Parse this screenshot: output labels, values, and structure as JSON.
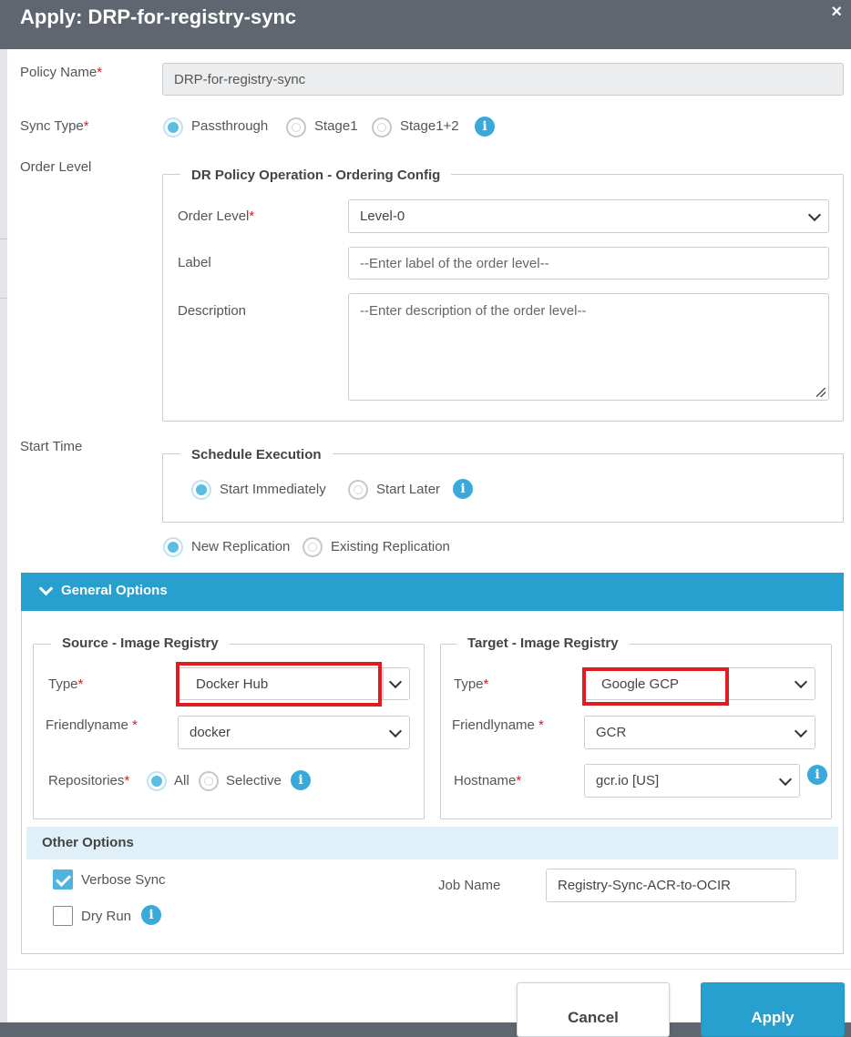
{
  "dialog": {
    "title": "Apply: DRP-for-registry-sync",
    "close_icon": "×"
  },
  "policy_name": {
    "label": "Policy Name",
    "value": "DRP-for-registry-sync"
  },
  "sync_type": {
    "label": "Sync Type",
    "options": [
      "Passthrough",
      "Stage1",
      "Stage1+2"
    ],
    "selected": "Passthrough"
  },
  "order_level": {
    "label": "Order Level",
    "legend": "DR Policy Operation - Ordering Config",
    "level_label": "Order Level",
    "level_value": "Level-0",
    "label_label": "Label",
    "label_placeholder": "--Enter label of the order level--",
    "description_label": "Description",
    "description_placeholder": "--Enter description of the order level--"
  },
  "start_time": {
    "label": "Start Time",
    "legend": "Schedule Execution",
    "options": [
      "Start Immediately",
      "Start Later"
    ],
    "selected": "Start Immediately"
  },
  "replication": {
    "options": [
      "New Replication",
      "Existing Replication"
    ],
    "selected": "New Replication"
  },
  "general_options": {
    "title": "General Options",
    "source": {
      "legend": "Source - Image Registry",
      "type_label": "Type",
      "type_value": "Docker Hub",
      "friendlyname_label": "Friendlyname",
      "friendlyname_value": "docker",
      "repositories_label": "Repositories",
      "repo_options": [
        "All",
        "Selective"
      ],
      "repo_selected": "All"
    },
    "target": {
      "legend": "Target - Image Registry",
      "type_label": "Type",
      "type_value": "Google GCP",
      "friendlyname_label": "Friendlyname",
      "friendlyname_value": "GCR",
      "hostname_label": "Hostname",
      "hostname_value": "gcr.io [US]"
    }
  },
  "other_options": {
    "title": "Other Options",
    "verbose_sync": {
      "label": "Verbose Sync",
      "checked": true
    },
    "dry_run": {
      "label": "Dry Run",
      "checked": false
    },
    "job_name_label": "Job Name",
    "job_name_value": "Registry-Sync-ACR-to-OCIR"
  },
  "footer": {
    "cancel_label": "Cancel",
    "apply_label": "Apply"
  },
  "icons": {
    "info": "i",
    "required_marker": "*"
  },
  "colors": {
    "header": "#5f6670",
    "accent": "#27a0cf",
    "highlight": "#e01b22",
    "required": "#d0202a"
  }
}
